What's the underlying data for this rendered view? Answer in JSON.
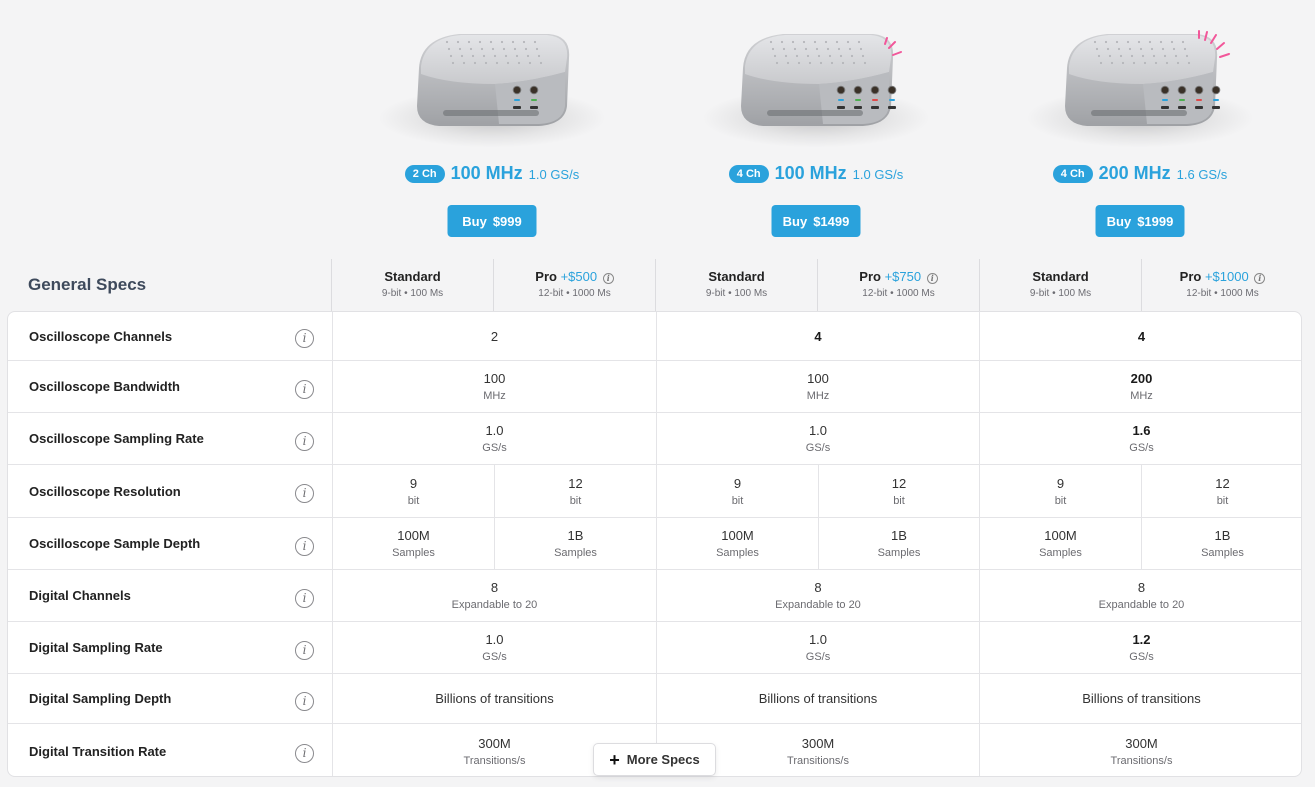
{
  "products": [
    {
      "channels": "2 Ch",
      "bandwidth": "100 MHz",
      "sampling": "1.0 GS/s",
      "buy_label": "Buy",
      "price": "$999",
      "sparkle": "none"
    },
    {
      "channels": "4 Ch",
      "bandwidth": "100 MHz",
      "sampling": "1.0 GS/s",
      "buy_label": "Buy",
      "price": "$1499",
      "sparkle": "small"
    },
    {
      "channels": "4 Ch",
      "bandwidth": "200 MHz",
      "sampling": "1.6 GS/s",
      "buy_label": "Buy",
      "price": "$1999",
      "sparkle": "large"
    }
  ],
  "section_title": "General Specs",
  "plans": [
    {
      "name": "Standard",
      "price": "",
      "desc": "9-bit • 100 Ms"
    },
    {
      "name": "Pro",
      "price": "+$500",
      "desc": "12-bit • 1000 Ms"
    },
    {
      "name": "Standard",
      "price": "",
      "desc": "9-bit • 100 Ms"
    },
    {
      "name": "Pro",
      "price": "+$750",
      "desc": "12-bit • 1000 Ms"
    },
    {
      "name": "Standard",
      "price": "",
      "desc": "9-bit • 100 Ms"
    },
    {
      "name": "Pro",
      "price": "+$1000",
      "desc": "12-bit • 1000 Ms"
    }
  ],
  "specs": [
    {
      "label": "Oscilloscope Channels",
      "split": false,
      "cells": [
        {
          "value": "2",
          "unit": "",
          "bold": false
        },
        {
          "value": "4",
          "unit": "",
          "bold": true
        },
        {
          "value": "4",
          "unit": "",
          "bold": true
        }
      ]
    },
    {
      "label": "Oscilloscope Bandwidth",
      "split": false,
      "cells": [
        {
          "value": "100",
          "unit": "MHz",
          "bold": false
        },
        {
          "value": "100",
          "unit": "MHz",
          "bold": false
        },
        {
          "value": "200",
          "unit": "MHz",
          "bold": true
        }
      ]
    },
    {
      "label": "Oscilloscope Sampling Rate",
      "split": false,
      "cells": [
        {
          "value": "1.0",
          "unit": "GS/s",
          "bold": false
        },
        {
          "value": "1.0",
          "unit": "GS/s",
          "bold": false
        },
        {
          "value": "1.6",
          "unit": "GS/s",
          "bold": true
        }
      ]
    },
    {
      "label": "Oscilloscope Resolution",
      "split": true,
      "cells": [
        {
          "value": "9",
          "unit": "bit",
          "bold": false
        },
        {
          "value": "12",
          "unit": "bit",
          "bold": false
        },
        {
          "value": "9",
          "unit": "bit",
          "bold": false
        },
        {
          "value": "12",
          "unit": "bit",
          "bold": false
        },
        {
          "value": "9",
          "unit": "bit",
          "bold": false
        },
        {
          "value": "12",
          "unit": "bit",
          "bold": false
        }
      ]
    },
    {
      "label": "Oscilloscope Sample Depth",
      "split": true,
      "cells": [
        {
          "value": "100M",
          "unit": "Samples",
          "bold": false
        },
        {
          "value": "1B",
          "unit": "Samples",
          "bold": false
        },
        {
          "value": "100M",
          "unit": "Samples",
          "bold": false
        },
        {
          "value": "1B",
          "unit": "Samples",
          "bold": false
        },
        {
          "value": "100M",
          "unit": "Samples",
          "bold": false
        },
        {
          "value": "1B",
          "unit": "Samples",
          "bold": false
        }
      ]
    },
    {
      "label": "Digital Channels",
      "split": false,
      "cells": [
        {
          "value": "8",
          "unit": "Expandable to 20",
          "bold": false
        },
        {
          "value": "8",
          "unit": "Expandable to 20",
          "bold": false
        },
        {
          "value": "8",
          "unit": "Expandable to 20",
          "bold": false
        }
      ]
    },
    {
      "label": "Digital Sampling Rate",
      "split": false,
      "cells": [
        {
          "value": "1.0",
          "unit": "GS/s",
          "bold": false
        },
        {
          "value": "1.0",
          "unit": "GS/s",
          "bold": false
        },
        {
          "value": "1.2",
          "unit": "GS/s",
          "bold": true
        }
      ]
    },
    {
      "label": "Digital Sampling Depth",
      "split": false,
      "cells": [
        {
          "value": "Billions of transitions",
          "unit": "",
          "bold": false
        },
        {
          "value": "Billions of transitions",
          "unit": "",
          "bold": false
        },
        {
          "value": "Billions of transitions",
          "unit": "",
          "bold": false
        }
      ]
    },
    {
      "label": "Digital Transition Rate",
      "split": false,
      "cells": [
        {
          "value": "300M",
          "unit": "Transitions/s",
          "bold": false
        },
        {
          "value": "300M",
          "unit": "Transitions/s",
          "bold": false
        },
        {
          "value": "300M",
          "unit": "Transitions/s",
          "bold": false
        }
      ]
    }
  ],
  "more_specs_label": "More Specs",
  "colors": {
    "accent": "#2aa2dc",
    "sparkle": "#f2579a"
  }
}
